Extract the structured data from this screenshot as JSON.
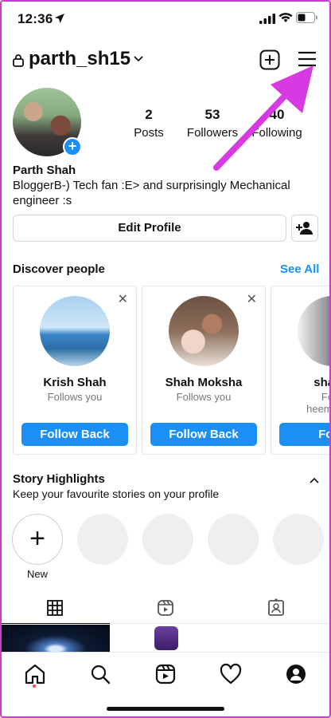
{
  "status_bar": {
    "time": "12:36"
  },
  "header": {
    "username": "parth_sh15"
  },
  "profile": {
    "posts_count": "2",
    "posts_label": "Posts",
    "followers_count": "53",
    "followers_label": "Followers",
    "following_count": "40",
    "following_label": "Following",
    "full_name": "Parth Shah",
    "bio": "BloggerB-) Tech fan :E> and surprisingly Mechanical engineer :s",
    "edit_profile_label": "Edit Profile"
  },
  "discover": {
    "title": "Discover people",
    "see_all": "See All",
    "cards": [
      {
        "name": "Krish Shah",
        "sub": "Follows you",
        "button": "Follow Back"
      },
      {
        "name": "Shah Moksha",
        "sub": "Follows you",
        "button": "Follow Back"
      },
      {
        "name": "shah k",
        "sub": "Follo",
        "sub2": "heema_par",
        "button": "Follo"
      }
    ]
  },
  "highlights": {
    "title": "Story Highlights",
    "subtitle": "Keep your favourite stories on your profile",
    "new_label": "New"
  },
  "colors": {
    "accent": "#1a8ff5",
    "annotation_arrow": "#d63ae0",
    "notification_dot": "#ed4956"
  }
}
